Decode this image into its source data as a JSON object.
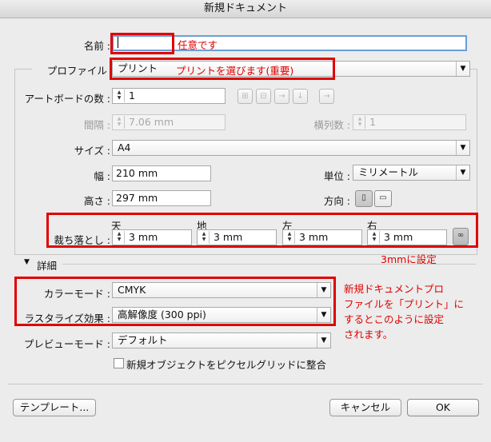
{
  "dialog": {
    "title": "新規ドキュメント"
  },
  "name": {
    "label": "名前 :",
    "value": "",
    "annotation": "任意です"
  },
  "profile": {
    "label": "プロファイル :",
    "value": "プリント",
    "annotation": "プリントを選びます(重要)"
  },
  "artboards": {
    "label": "アートボードの数 :",
    "value": "1",
    "layout_icons": [
      "grid-by-row-icon",
      "grid-by-column-icon",
      "arrange-by-row-icon",
      "arrange-by-column-icon",
      "right-to-left-icon"
    ]
  },
  "spacing": {
    "label": "間隔 :",
    "value": "7.06 mm"
  },
  "columns": {
    "label": "横列数 :",
    "value": "1"
  },
  "size": {
    "label": "サイズ :",
    "value": "A4"
  },
  "width": {
    "label": "幅 :",
    "value": "210 mm"
  },
  "units": {
    "label": "単位 :",
    "value": "ミリメートル"
  },
  "height": {
    "label": "高さ :",
    "value": "297 mm"
  },
  "orientation": {
    "label": "方向 :",
    "options": [
      "portrait",
      "landscape"
    ]
  },
  "bleed": {
    "label": "裁ち落とし :",
    "annotation": "3mmに設定",
    "fields": [
      {
        "label": "天",
        "value": "3 mm"
      },
      {
        "label": "地",
        "value": "3 mm"
      },
      {
        "label": "左",
        "value": "3 mm"
      },
      {
        "label": "右",
        "value": "3 mm"
      }
    ]
  },
  "advanced": {
    "label": "詳細"
  },
  "color_mode": {
    "label": "カラーモード :",
    "value": "CMYK"
  },
  "raster_effects": {
    "label": "ラスタライズ効果 :",
    "value": "高解像度 (300 ppi)"
  },
  "preview_mode": {
    "label": "プレビューモード :",
    "value": "デフォルト"
  },
  "pixel_grid": {
    "label": "新規オブジェクトをピクセルグリッドに整合",
    "checked": false
  },
  "annotation_note": [
    "新規ドキュメントプロ",
    "ファイルを「プリント」に",
    "するとこのように設定",
    "されます。"
  ],
  "buttons": {
    "template": "テンプレート...",
    "cancel": "キャンセル",
    "ok": "OK"
  },
  "colors": {
    "annotation_red": "#e00000",
    "name_field_focus": "#6a9fd8",
    "ok_button_default": "#8a8a8a"
  }
}
